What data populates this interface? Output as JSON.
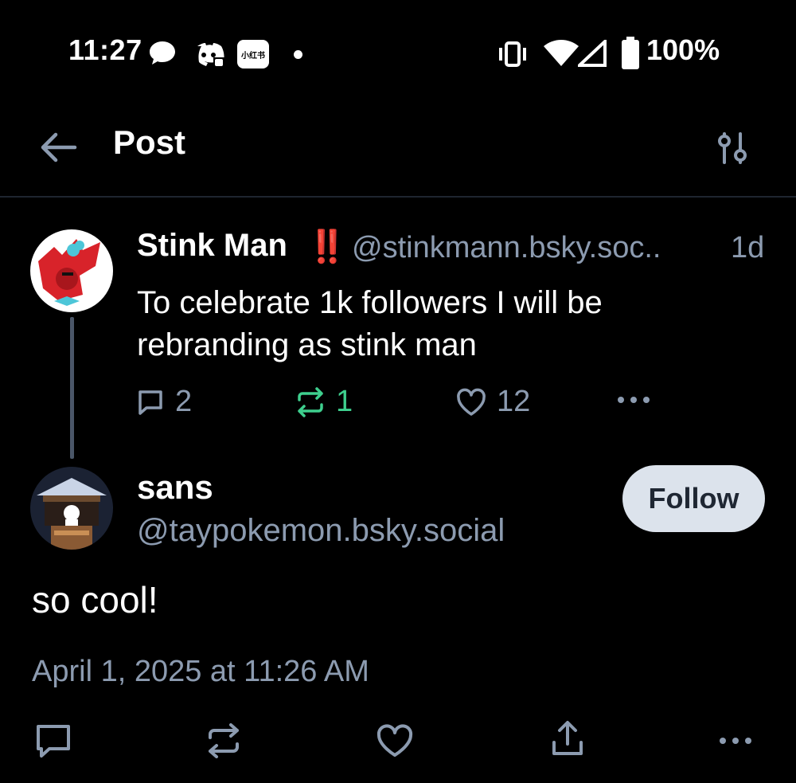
{
  "status_bar": {
    "time": "11:27",
    "battery_percent": "100%",
    "app_badge_text": "小红书",
    "icons": [
      "chat-bubble-icon",
      "discord-icon",
      "xiaohongshu-icon",
      "dot-icon",
      "vibrate-icon",
      "wifi-icon",
      "signal-icon",
      "battery-icon"
    ]
  },
  "header": {
    "title": "Post",
    "back_icon": "back-arrow-icon",
    "settings_icon": "sliders-icon"
  },
  "parent_post": {
    "author_name": "Stink Man",
    "author_emoji": "‼️",
    "author_handle": "@stinkmann.bsky.soc..",
    "age": "1d",
    "text": "To celebrate 1k followers I will be rebranding as stink man",
    "replies": "2",
    "reposts": "1",
    "likes": "12"
  },
  "reply_post": {
    "author_name": "sans",
    "author_handle": "@taypokemon.bsky.social",
    "follow_label": "Follow",
    "text": "so cool!",
    "timestamp": "April 1, 2025 at 11:26 AM"
  },
  "colors": {
    "background": "#000000",
    "muted_text": "#8c9bb0",
    "repost_active": "#3ecf8e",
    "follow_button_bg": "#dce3ec",
    "divider": "#1e2530"
  }
}
